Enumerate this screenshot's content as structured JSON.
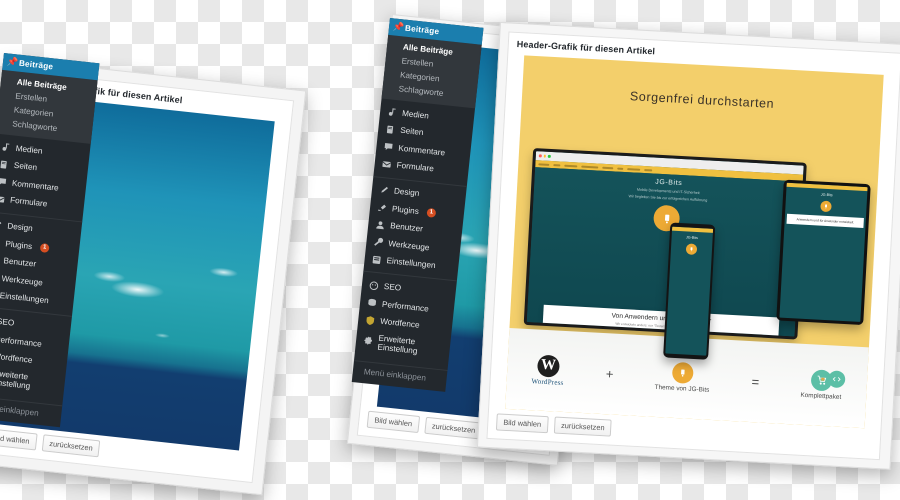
{
  "background": {
    "type": "transparency-checkerboard",
    "colors": [
      "#ffffff",
      "#e8e8e8"
    ]
  },
  "theme": {
    "wp_blue": "#1b7eae",
    "wp_dark": "#23282d",
    "wp_submenu": "#32373c",
    "badge_orange": "#d54e21",
    "promo_yellow": "#f3cf6b",
    "promo_teal": "#14535a",
    "accent_orange": "#edaa35",
    "accent_green": "#5cbfa6"
  },
  "sidebar": {
    "header": {
      "label": "Beiträge",
      "icon": "pin-icon"
    },
    "submenu": [
      {
        "label": "Alle Beiträge",
        "current": true
      },
      {
        "label": "Erstellen",
        "current": false
      },
      {
        "label": "Kategorien",
        "current": false
      },
      {
        "label": "Schlagworte",
        "current": false
      }
    ],
    "group1": [
      {
        "label": "Medien",
        "icon": "media-icon"
      },
      {
        "label": "Seiten",
        "icon": "pages-icon"
      },
      {
        "label": "Kommentare",
        "icon": "comment-icon"
      },
      {
        "label": "Formulare",
        "icon": "envelope-icon"
      }
    ],
    "group2": [
      {
        "label": "Design",
        "icon": "brush-icon"
      },
      {
        "label": "Plugins",
        "icon": "plug-icon",
        "badge": "1"
      },
      {
        "label": "Benutzer",
        "icon": "user-icon"
      },
      {
        "label": "Werkzeuge",
        "icon": "wrench-icon"
      },
      {
        "label": "Einstellungen",
        "icon": "sliders-icon"
      }
    ],
    "group3": [
      {
        "label": "SEO",
        "icon": "seo-icon"
      },
      {
        "label": "Performance",
        "icon": "performance-icon"
      },
      {
        "label": "Wordfence",
        "icon": "shield-icon"
      },
      {
        "label": "Erweiterte Einstellung",
        "icon": "gear-icon"
      }
    ],
    "collapse": {
      "label": "Menü einklappen",
      "icon": "collapse-icon"
    }
  },
  "panel_back": {
    "title": "Hintergrund-Grafik für diesen Artikel",
    "image_alt": "sky-and-sea-photo",
    "buttons": {
      "choose": "Bild wählen",
      "reset": "zurücksetzen"
    }
  },
  "panel_header": {
    "title": "Header-Grafik für diesen Artikel",
    "buttons": {
      "choose": "Bild wählen",
      "reset": "zurücksetzen"
    },
    "promo": {
      "headline": "Sorgenfrei durchstarten",
      "site_brand": "JG-Bits",
      "site_tagline_1": "Mobile Developments und IT-Sicherheit",
      "site_tagline_2": "Wir begleiten Sie bis zur erfolgreichen Aufführung",
      "card_heading": "Von Anwendern und für Anwender",
      "card_line_1": "Wir entwickeln anders: nur \"Texten\" können wir uns professionell",
      "card_line_2": "individuell auf Sie und Ihre Zielgruppe zugeschnitten",
      "mobile_brand": "JG-Bits",
      "mobile_heading": "Anwendern und für Anwender entwickelt.",
      "code_badge_icon": "code-icon",
      "equation": {
        "wordpress_label": "WordPress",
        "plus": "+",
        "theme_label": "Theme von JG-Bits",
        "equals": "=",
        "package_label": "Komplettpaket"
      }
    }
  }
}
